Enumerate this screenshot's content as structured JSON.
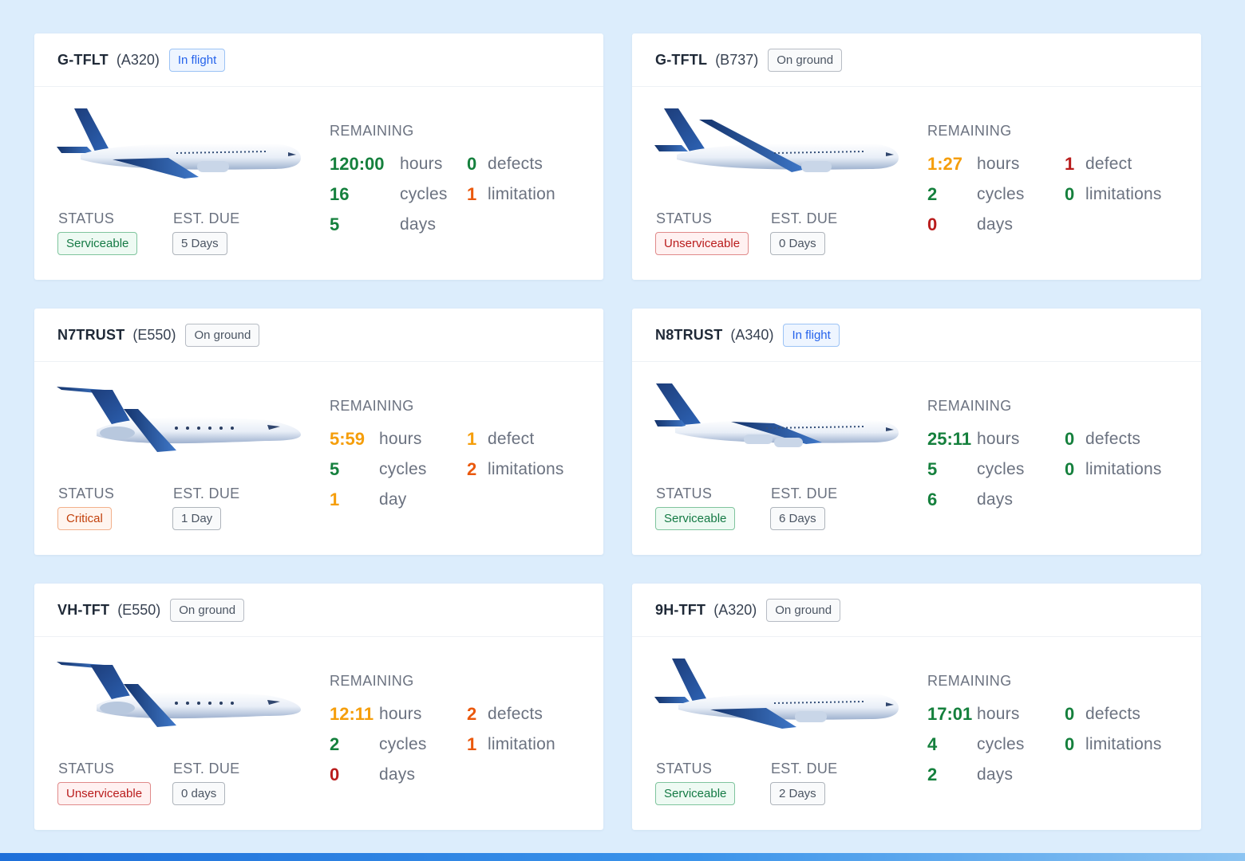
{
  "labels": {
    "status": "STATUS",
    "est_due": "EST. DUE",
    "remaining": "REMAINING"
  },
  "colors": {
    "green": "#15803d",
    "orange": "#f59e0b",
    "red": "#b91c1c",
    "dark_orange": "#ea580c",
    "accent": "#2563eb"
  },
  "aircraft": [
    {
      "registration": "G-TFLT",
      "model": "(A320)",
      "location": "In flight",
      "aircraft_icon": "narrowbody-airplane-icon",
      "status": "Serviceable",
      "est_due": "5 Days",
      "hours": "120:00",
      "hours_unit": "hours",
      "cycles": "16",
      "cycles_unit": "cycles",
      "days": "5",
      "days_unit": "days",
      "defects": "0",
      "defects_unit": "defects",
      "limitations": "1",
      "limitations_unit": "limitation"
    },
    {
      "registration": "G-TFTL",
      "model": "(B737)",
      "location": "On ground",
      "aircraft_icon": "narrowbody-airplane-icon",
      "status": "Unserviceable",
      "est_due": "0 Days",
      "hours": "1:27",
      "hours_unit": "hours",
      "cycles": "2",
      "cycles_unit": "cycles",
      "days": "0",
      "days_unit": "days",
      "defects": "1",
      "defects_unit": "defect",
      "limitations": "0",
      "limitations_unit": "limitations"
    },
    {
      "registration": "N7TRUST",
      "model": "(E550)",
      "location": "On ground",
      "aircraft_icon": "business-jet-icon",
      "status": "Critical",
      "est_due": "1 Day",
      "hours": "5:59",
      "hours_unit": "hours",
      "cycles": "5",
      "cycles_unit": "cycles",
      "days": "1",
      "days_unit": "day",
      "defects": "1",
      "defects_unit": "defect",
      "limitations": "2",
      "limitations_unit": "limitations"
    },
    {
      "registration": "N8TRUST",
      "model": "(A340)",
      "location": "In flight",
      "aircraft_icon": "widebody-airplane-icon",
      "status": "Serviceable",
      "est_due": "6 Days",
      "hours": "25:11",
      "hours_unit": "hours",
      "cycles": "5",
      "cycles_unit": "cycles",
      "days": "6",
      "days_unit": "days",
      "defects": "0",
      "defects_unit": "defects",
      "limitations": "0",
      "limitations_unit": "limitations"
    },
    {
      "registration": "VH-TFT",
      "model": "(E550)",
      "location": "On ground",
      "aircraft_icon": "business-jet-icon",
      "status": "Unserviceable",
      "est_due": "0 days",
      "hours": "12:11",
      "hours_unit": "hours",
      "cycles": "2",
      "cycles_unit": "cycles",
      "days": "0",
      "days_unit": "days",
      "defects": "2",
      "defects_unit": "defects",
      "limitations": "1",
      "limitations_unit": "limitation"
    },
    {
      "registration": "9H-TFT",
      "model": "(A320)",
      "location": "On ground",
      "aircraft_icon": "narrowbody-airplane-icon",
      "status": "Serviceable",
      "est_due": "2 Days",
      "hours": "17:01",
      "hours_unit": "hours",
      "cycles": "4",
      "cycles_unit": "cycles",
      "days": "2",
      "days_unit": "days",
      "defects": "0",
      "defects_unit": "defects",
      "limitations": "0",
      "limitations_unit": "limitations"
    }
  ]
}
